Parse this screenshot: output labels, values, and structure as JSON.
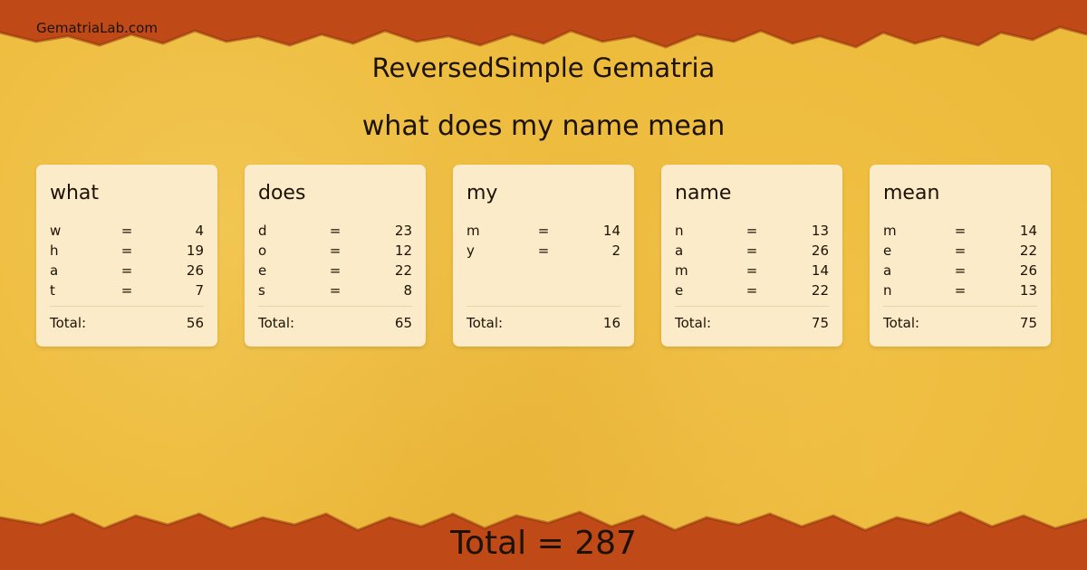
{
  "site": "GematriaLab.com",
  "title": "ReversedSimple Gematria",
  "phrase": "what does my name mean",
  "total_label": "Total:",
  "eq": "=",
  "grand_total": "Total = 287",
  "colors": {
    "background": "#edbb3b",
    "edge": "#bf4a17",
    "card": "#fbebc8"
  },
  "words": [
    {
      "word": "what",
      "letters": [
        {
          "l": "w",
          "v": "4"
        },
        {
          "l": "h",
          "v": "19"
        },
        {
          "l": "a",
          "v": "26"
        },
        {
          "l": "t",
          "v": "7"
        }
      ],
      "total": "56"
    },
    {
      "word": "does",
      "letters": [
        {
          "l": "d",
          "v": "23"
        },
        {
          "l": "o",
          "v": "12"
        },
        {
          "l": "e",
          "v": "22"
        },
        {
          "l": "s",
          "v": "8"
        }
      ],
      "total": "65"
    },
    {
      "word": "my",
      "letters": [
        {
          "l": "m",
          "v": "14"
        },
        {
          "l": "y",
          "v": "2"
        }
      ],
      "total": "16"
    },
    {
      "word": "name",
      "letters": [
        {
          "l": "n",
          "v": "13"
        },
        {
          "l": "a",
          "v": "26"
        },
        {
          "l": "m",
          "v": "14"
        },
        {
          "l": "e",
          "v": "22"
        }
      ],
      "total": "75"
    },
    {
      "word": "mean",
      "letters": [
        {
          "l": "m",
          "v": "14"
        },
        {
          "l": "e",
          "v": "22"
        },
        {
          "l": "a",
          "v": "26"
        },
        {
          "l": "n",
          "v": "13"
        }
      ],
      "total": "75"
    }
  ]
}
